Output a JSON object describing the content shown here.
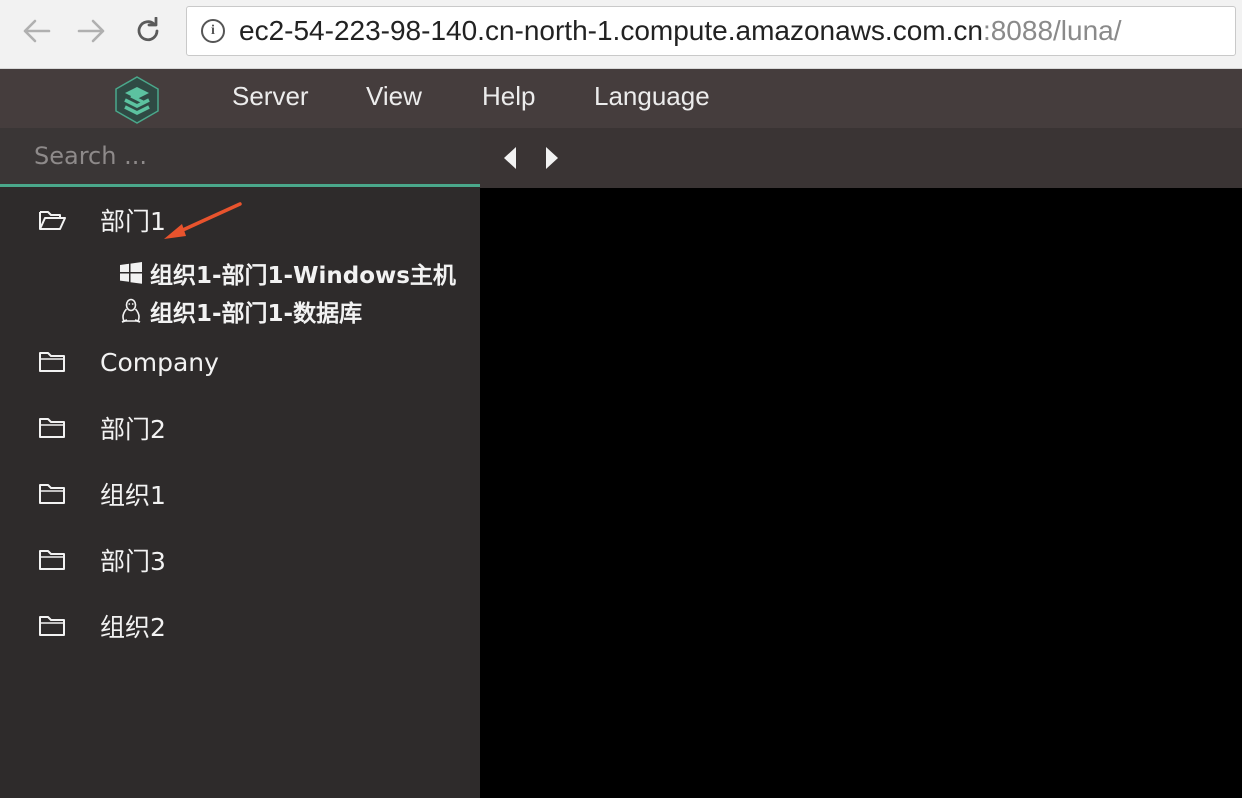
{
  "browser": {
    "url_host": "ec2-54-223-98-140.cn-north-1.compute.amazonaws.com.cn",
    "url_rest": ":8088/luna/"
  },
  "header": {
    "menu": [
      "Server",
      "View",
      "Help",
      "Language"
    ]
  },
  "sidebar": {
    "search_placeholder": "Search ...",
    "groups": [
      {
        "label": "部门1",
        "open": true
      },
      {
        "label": "Company",
        "open": false
      },
      {
        "label": "部门2",
        "open": false
      },
      {
        "label": "组织1",
        "open": false
      },
      {
        "label": "部门3",
        "open": false
      },
      {
        "label": "组织2",
        "open": false
      }
    ],
    "hosts": [
      {
        "label": "组织1-部门1-Windows主机",
        "icon": "windows-icon"
      },
      {
        "label": "组织1-部门1-数据库",
        "icon": "linux-icon"
      }
    ]
  },
  "colors": {
    "header_bg": "#453d3d",
    "sidebar_bg": "#2e2b2b",
    "accent": "#4aa88b",
    "annotation": "#e8532d"
  }
}
